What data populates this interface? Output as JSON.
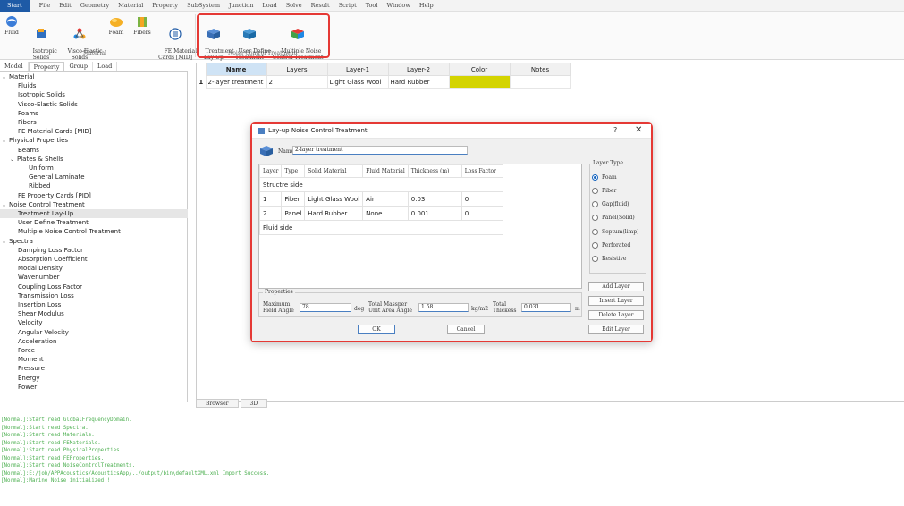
{
  "menu": [
    "Start",
    "File",
    "Edit",
    "Geometry",
    "Material",
    "Property",
    "SubSystem",
    "Junction",
    "Load",
    "Solve",
    "Result",
    "Script",
    "Tool",
    "Window",
    "Help"
  ],
  "ribbon": {
    "material_buttons": [
      {
        "label": "Fluid",
        "icon": "fluid-icon"
      },
      {
        "label": "Isotropic\nSolids",
        "icon": "isotropic-solids-icon"
      },
      {
        "label": "Visco-Elastic\nSolids",
        "icon": "visco-elastic-icon"
      },
      {
        "label": "Foam",
        "icon": "foam-icon"
      },
      {
        "label": "Fibers",
        "icon": "fibers-icon"
      },
      {
        "label": "FE Material\nCards [MID]",
        "icon": "fe-material-cards-icon"
      }
    ],
    "material_group": "Material",
    "noise_buttons": [
      {
        "label": "Treatment\nLay-Up",
        "icon": "treatment-layup-icon"
      },
      {
        "label": "User Define\nTreatment",
        "icon": "user-define-treatment-icon"
      },
      {
        "label": "Multiple Noise\nControl Treatment",
        "icon": "multiple-noise-icon"
      }
    ],
    "noise_group": "Noise Control Treatment"
  },
  "left_tabs": [
    "Model",
    "Property",
    "Group",
    "Load"
  ],
  "tree": [
    {
      "label": "Material",
      "level": 0,
      "chev": "⌄"
    },
    {
      "label": "Fluids",
      "level": 1
    },
    {
      "label": "Isotropic Solids",
      "level": 1
    },
    {
      "label": "Visco-Elastic Solids",
      "level": 1
    },
    {
      "label": "Foams",
      "level": 1
    },
    {
      "label": "Fibers",
      "level": 1
    },
    {
      "label": "FE Material Cards [MID]",
      "level": 1
    },
    {
      "label": "Physical Properties",
      "level": 0,
      "chev": "⌄"
    },
    {
      "label": "Beams",
      "level": 1
    },
    {
      "label": "Plates & Shells",
      "level": 1,
      "chev": "⌄"
    },
    {
      "label": "Uniform",
      "level": 2
    },
    {
      "label": "General Laminate",
      "level": 2
    },
    {
      "label": "Ribbed",
      "level": 2
    },
    {
      "label": "FE Property Cards [PID]",
      "level": 1
    },
    {
      "label": "Noise Control Treatment",
      "level": 0,
      "chev": "⌄"
    },
    {
      "label": "Treatment Lay-Up",
      "level": 1,
      "selected": true
    },
    {
      "label": "User Define Treatment",
      "level": 1
    },
    {
      "label": "Multiple Noise Control Treatment",
      "level": 1
    },
    {
      "label": "Spectra",
      "level": 0,
      "chev": "⌄"
    },
    {
      "label": "Damping Loss Factor",
      "level": 1
    },
    {
      "label": "Absorption Coefficient",
      "level": 1
    },
    {
      "label": "Modal Density",
      "level": 1
    },
    {
      "label": "Wavenumber",
      "level": 1
    },
    {
      "label": "Coupling Loss Factor",
      "level": 1
    },
    {
      "label": "Transmission Loss",
      "level": 1
    },
    {
      "label": "Insertion Loss",
      "level": 1
    },
    {
      "label": "Shear Modulus",
      "level": 1
    },
    {
      "label": "Velocity",
      "level": 1
    },
    {
      "label": "Angular Velocity",
      "level": 1
    },
    {
      "label": "Acceleration",
      "level": 1
    },
    {
      "label": "Force",
      "level": 1
    },
    {
      "label": "Moment",
      "level": 1
    },
    {
      "label": "Pressure",
      "level": 1
    },
    {
      "label": "Energy",
      "level": 1
    },
    {
      "label": "Power",
      "level": 1
    }
  ],
  "table": {
    "headers": [
      "Name",
      "Layers",
      "Layer-1",
      "Layer-2",
      "Color",
      "Notes"
    ],
    "rows": [
      {
        "num": "1",
        "name": "2-layer treatment",
        "layers": "2",
        "layer1": "Light Glass Wool",
        "layer2": "Hard Rubber",
        "color": "#d4d400",
        "notes": ""
      }
    ]
  },
  "bottom_tabs": [
    "Browser",
    "3D"
  ],
  "log": [
    "[Normal]:Start read GlobalFrequencyDomain.",
    "[Normal]:Start read Spectra.",
    "[Normal]:Start read Materials.",
    "[Normal]:Start read FEMaterials.",
    "[Normal]:Start read PhysicalProperties.",
    "[Normal]:Start read FEProperties.",
    "[Normal]:Start read NoiseControlTreatments.",
    "[Normal]:E:/job/APPAcoustics/AcousticsApp/../output/bin\\defaultXML.xml Import Success.",
    "[Normal]:Marine Noise initialized !"
  ],
  "dialog": {
    "title": "Lay-up Noise Control Treatment",
    "help": "?",
    "close": "✕",
    "name_label": "Name",
    "name_value": "2-layer treatment",
    "layer_headers": [
      "Layer",
      "Type",
      "Solid Material",
      "Fluid Material",
      "Thickness (m)",
      "Loss Factor"
    ],
    "structure_side": "Structre side",
    "fluid_side": "Fluid side",
    "layers": [
      {
        "layer": "1",
        "type": "Fiber",
        "solid": "Light Glass Wool",
        "fluid": "Air",
        "thickness": "0.03",
        "loss": "0"
      },
      {
        "layer": "2",
        "type": "Panel",
        "solid": "Hard Rubber",
        "fluid": "None",
        "thickness": "0.001",
        "loss": "0"
      }
    ],
    "layer_type_label": "Layer Type",
    "layer_types": [
      "Foam",
      "Fiber",
      "Gap(fluid)",
      "Panel(Solid)",
      "Septum(limp)",
      "Perforated",
      "Resistive"
    ],
    "selected_type": "Foam",
    "buttons": {
      "add": "Add Layer",
      "insert": "Insert Layer",
      "delete": "Delete Layer",
      "edit": "Edit Layer",
      "ok": "OK",
      "cancel": "Cancel"
    },
    "properties": {
      "label": "Properties",
      "max_field_angle_label_1": "Maximum",
      "max_field_angle_label_2": "Field Angle",
      "max_field_angle": "78",
      "max_field_angle_unit": "deg",
      "mass_label_1": "Total Massper",
      "mass_label_2": "Unit Area Angle",
      "mass": "1.58",
      "mass_unit": "kg/m2",
      "thickness_label_1": "Total",
      "thickness_label_2": "Thickess",
      "thickness": "0.031",
      "thickness_unit": "m"
    }
  }
}
